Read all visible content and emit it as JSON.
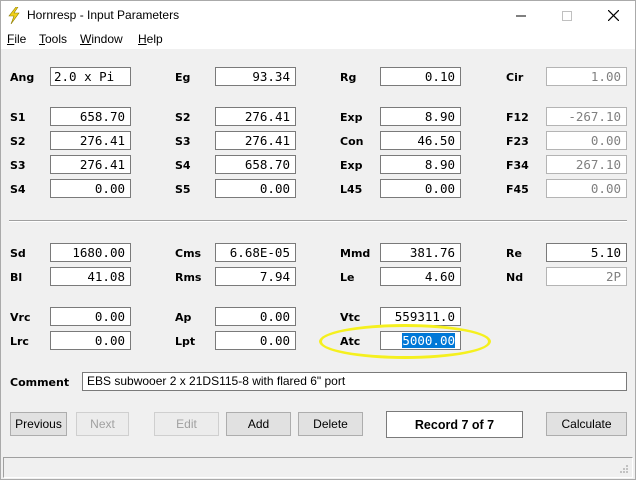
{
  "window": {
    "title": "Hornresp - Input Parameters",
    "minimize": "—",
    "maximize": "☐",
    "close": "✕"
  },
  "menu": {
    "file": "File",
    "tools": "Tools",
    "window": "Window",
    "help": "Help"
  },
  "params": {
    "ang": {
      "label": "Ang",
      "value": "2.0 x Pi"
    },
    "eg": {
      "label": "Eg",
      "value": "93.34"
    },
    "rg": {
      "label": "Rg",
      "value": "0.10"
    },
    "cir": {
      "label": "Cir",
      "value": "1.00"
    },
    "s1": {
      "label": "S1",
      "value": "658.70"
    },
    "s2a": {
      "label": "S2",
      "value": "276.41"
    },
    "exp1": {
      "label": "Exp",
      "value": "8.90"
    },
    "f12": {
      "label": "F12",
      "value": "-267.10"
    },
    "s2b": {
      "label": "S2",
      "value": "276.41"
    },
    "s3a": {
      "label": "S3",
      "value": "276.41"
    },
    "con": {
      "label": "Con",
      "value": "46.50"
    },
    "f23": {
      "label": "F23",
      "value": "0.00"
    },
    "s3b": {
      "label": "S3",
      "value": "276.41"
    },
    "s4a": {
      "label": "S4",
      "value": "658.70"
    },
    "exp2": {
      "label": "Exp",
      "value": "8.90"
    },
    "f34": {
      "label": "F34",
      "value": "267.10"
    },
    "s4b": {
      "label": "S4",
      "value": "0.00"
    },
    "s5": {
      "label": "S5",
      "value": "0.00"
    },
    "l45": {
      "label": "L45",
      "value": "0.00"
    },
    "f45": {
      "label": "F45",
      "value": "0.00"
    },
    "sd": {
      "label": "Sd",
      "value": "1680.00"
    },
    "cms": {
      "label": "Cms",
      "value": "6.68E-05"
    },
    "mmd": {
      "label": "Mmd",
      "value": "381.76"
    },
    "re": {
      "label": "Re",
      "value": "5.10"
    },
    "bl": {
      "label": "Bl",
      "value": "41.08"
    },
    "rms": {
      "label": "Rms",
      "value": "7.94"
    },
    "le": {
      "label": "Le",
      "value": "4.60"
    },
    "nd": {
      "label": "Nd",
      "value": "2P"
    },
    "vrc": {
      "label": "Vrc",
      "value": "0.00"
    },
    "ap": {
      "label": "Ap",
      "value": "0.00"
    },
    "vtc": {
      "label": "Vtc",
      "value": "559311.0"
    },
    "lrc": {
      "label": "Lrc",
      "value": "0.00"
    },
    "lpt": {
      "label": "Lpt",
      "value": "0.00"
    },
    "atc": {
      "label": "Atc",
      "value": "5000.00"
    }
  },
  "comment": {
    "label": "Comment",
    "value": "EBS subwooer 2 x 21DS115-8 with flared 6\" port"
  },
  "buttons": {
    "previous": "Previous",
    "next": "Next",
    "edit": "Edit",
    "add": "Add",
    "delete": "Delete",
    "calculate": "Calculate"
  },
  "record": "Record 7 of 7",
  "colors": {
    "highlight": "#f5f01e",
    "selection": "#0078d7"
  }
}
